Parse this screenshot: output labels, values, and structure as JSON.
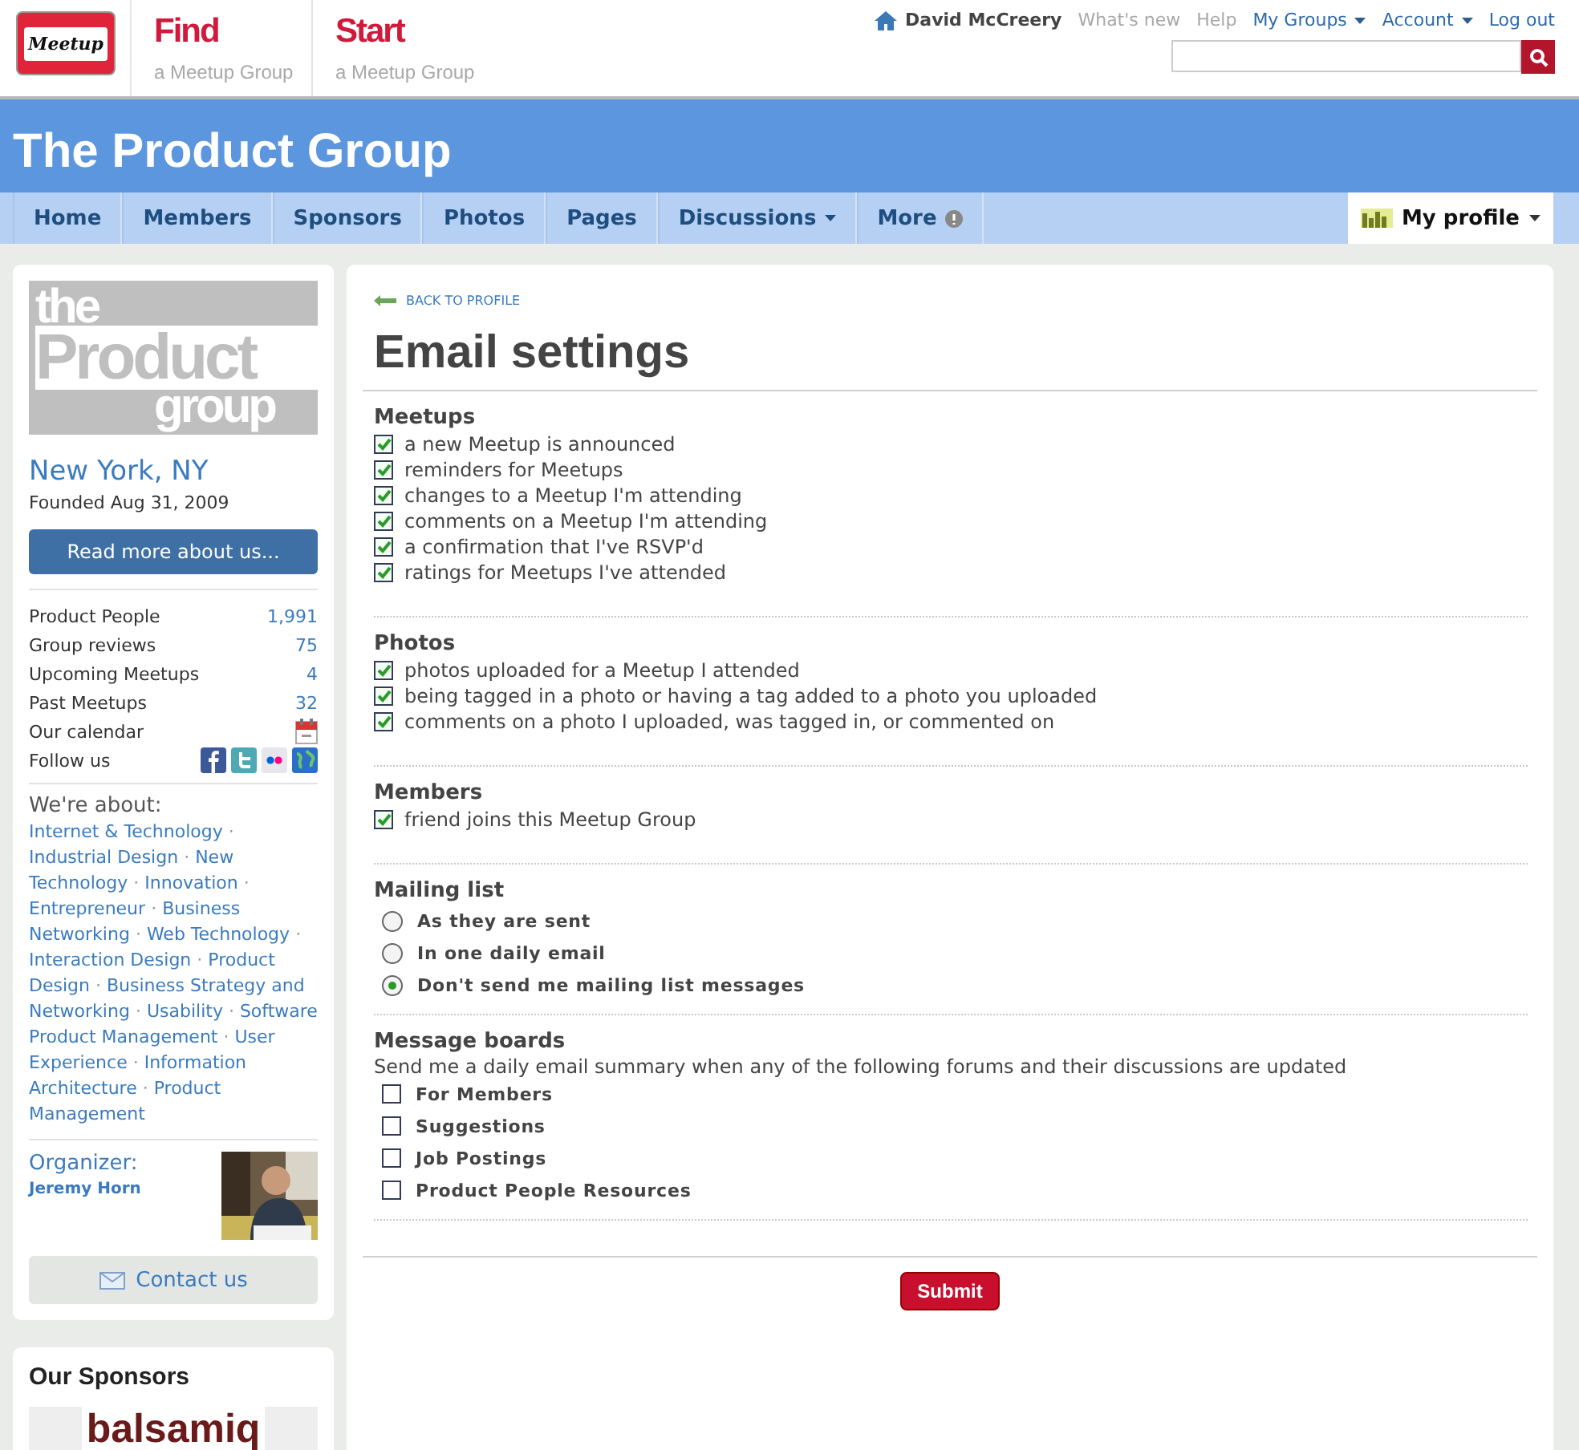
{
  "header": {
    "logo": "Meetup",
    "actions": [
      {
        "title": "Find",
        "subtitle": "a Meetup Group"
      },
      {
        "title": "Start",
        "subtitle": "a Meetup Group"
      }
    ],
    "user": "David McCreery",
    "links": [
      {
        "label": "What's new",
        "menu": false,
        "kind": "muted"
      },
      {
        "label": "Help",
        "menu": false,
        "kind": "muted"
      },
      {
        "label": "My Groups",
        "menu": true,
        "kind": "link"
      },
      {
        "label": "Account",
        "menu": true,
        "kind": "link"
      },
      {
        "label": "Log out",
        "menu": false,
        "kind": "link"
      }
    ]
  },
  "group_title": "The Product Group",
  "nav": {
    "items": [
      {
        "label": "Home",
        "menu": false,
        "alert": false
      },
      {
        "label": "Members",
        "menu": false,
        "alert": false
      },
      {
        "label": "Sponsors",
        "menu": false,
        "alert": false
      },
      {
        "label": "Photos",
        "menu": false,
        "alert": false
      },
      {
        "label": "Pages",
        "menu": false,
        "alert": false
      },
      {
        "label": "Discussions",
        "menu": true,
        "alert": false
      },
      {
        "label": "More",
        "menu": false,
        "alert": true
      }
    ],
    "profile": {
      "label": "My profile",
      "menu": true
    }
  },
  "sidebar": {
    "logo_lines": [
      "the",
      "Product",
      "group"
    ],
    "location": "New York, NY",
    "founded": "Founded Aug 31, 2009",
    "about_button": "Read more about us...",
    "stats": [
      {
        "label": "Product People",
        "value": "1,991",
        "kind": "number"
      },
      {
        "label": "Group reviews",
        "value": "75",
        "kind": "number"
      },
      {
        "label": "Upcoming Meetups",
        "value": "4",
        "kind": "number"
      },
      {
        "label": "Past Meetups",
        "value": "32",
        "kind": "number"
      },
      {
        "label": "Our calendar",
        "kind": "calendar"
      },
      {
        "label": "Follow us",
        "kind": "social"
      }
    ],
    "about_heading": "We're about:",
    "topic_separator": "·",
    "topics": [
      "Internet & Technology",
      "Industrial Design",
      "New Technology",
      "Innovation",
      "Entrepreneur",
      "Business Networking",
      "Web Technology",
      "Interaction Design",
      "Product Design",
      "Business Strategy and Networking",
      "Usability",
      "Software Product Management",
      "User Experience",
      "Information Architecture",
      "Product Management"
    ],
    "organizer_label": "Organizer:",
    "organizer": "Jeremy Horn",
    "contact_button": "Contact us",
    "sponsors_heading": "Our Sponsors",
    "sponsor": "balsamiq"
  },
  "main": {
    "back_link": "BACK TO PROFILE",
    "title": "Email settings",
    "sections": [
      {
        "heading": "Meetups",
        "kind": "checkbox",
        "options": [
          {
            "label": "a new Meetup is announced",
            "checked": true
          },
          {
            "label": "reminders for Meetups",
            "checked": true
          },
          {
            "label": "changes to a Meetup I'm attending",
            "checked": true
          },
          {
            "label": "comments on a Meetup I'm attending",
            "checked": true
          },
          {
            "label": "a confirmation that I've RSVP'd",
            "checked": true
          },
          {
            "label": "ratings for Meetups I've attended",
            "checked": true
          }
        ]
      },
      {
        "heading": "Photos",
        "kind": "checkbox",
        "options": [
          {
            "label": "photos uploaded for a Meetup I attended",
            "checked": true
          },
          {
            "label": "being tagged in a photo or having a tag added to a photo you uploaded",
            "checked": true
          },
          {
            "label": "comments on a photo I uploaded, was tagged in, or commented on",
            "checked": true
          }
        ]
      },
      {
        "heading": "Members",
        "kind": "checkbox",
        "options": [
          {
            "label": "friend joins this Meetup Group",
            "checked": true
          }
        ]
      },
      {
        "heading": "Mailing list",
        "kind": "radio",
        "options": [
          {
            "label": "As they are sent",
            "selected": false
          },
          {
            "label": "In one daily email",
            "selected": false
          },
          {
            "label": "Don't send me mailing list messages",
            "selected": true
          }
        ]
      },
      {
        "heading": "Message boards",
        "kind": "boldcheckbox",
        "note": "Send me a daily email summary when any of the following forums and their discussions are updated",
        "options": [
          {
            "label": "For Members",
            "checked": false
          },
          {
            "label": "Suggestions",
            "checked": false
          },
          {
            "label": "Job Postings",
            "checked": false
          },
          {
            "label": "Product People Resources",
            "checked": false
          }
        ]
      }
    ],
    "submit": "Submit"
  }
}
